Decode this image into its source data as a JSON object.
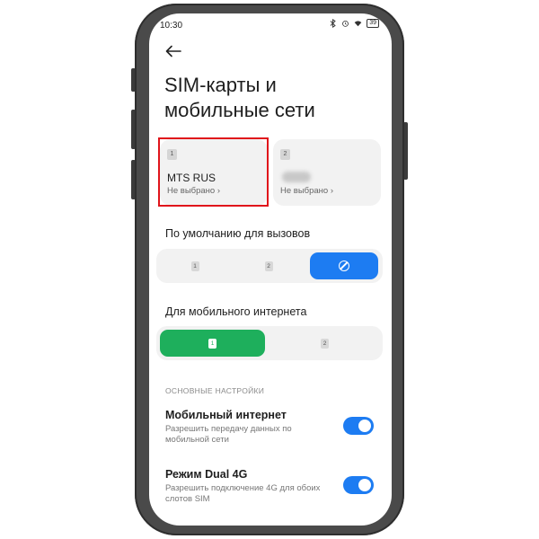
{
  "statusbar": {
    "time": "10:30",
    "battery": "39",
    "icons": [
      "bluetooth-icon",
      "alarm-icon",
      "wifi-icon",
      "battery-icon"
    ]
  },
  "header": {
    "back_icon": "arrow-left-icon",
    "title": "SIM-карты и мобильные сети"
  },
  "sims": [
    {
      "slot": "1",
      "name": "MTS RUS",
      "subtitle": "Не выбрано",
      "highlighted": true
    },
    {
      "slot": "2",
      "name": "",
      "subtitle": "Не выбрано",
      "name_blurred": true
    }
  ],
  "calls": {
    "label": "По умолчанию для вызовов",
    "options": [
      "1",
      "2"
    ],
    "selected_icon": "ban-icon"
  },
  "mobile_data": {
    "label": "Для мобильного интернета",
    "options": [
      "1",
      "2"
    ],
    "selected": "1"
  },
  "settings": {
    "group_header": "ОСНОВНЫЕ НАСТРОЙКИ",
    "items": [
      {
        "title": "Мобильный интернет",
        "description": "Разрешить передачу данных по мобильной сети",
        "enabled": true
      },
      {
        "title": "Режим Dual 4G",
        "description": "Разрешить подключение 4G для обоих слотов SIM",
        "enabled": true
      }
    ]
  },
  "colors": {
    "accent_blue": "#1d7cf2",
    "accent_green": "#1eaf5c",
    "highlight_red": "#e0141b"
  }
}
